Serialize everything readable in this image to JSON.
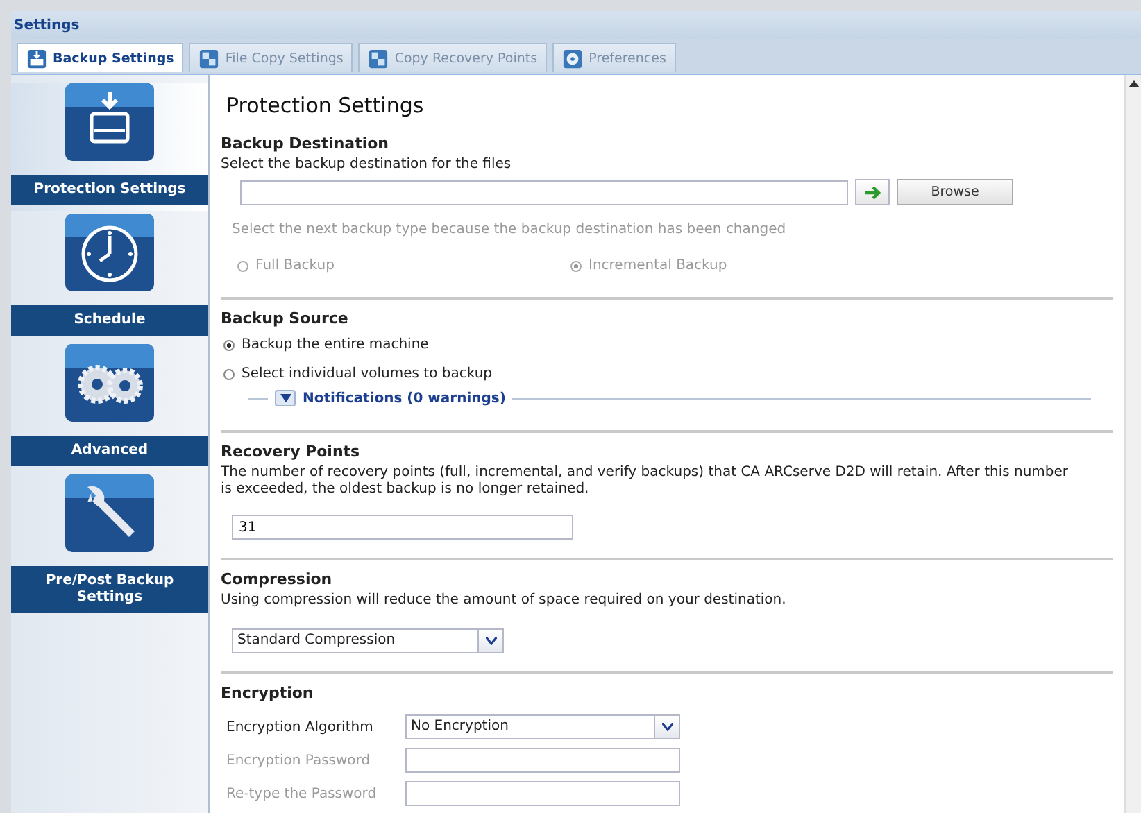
{
  "window": {
    "title": "Settings"
  },
  "tabs": [
    {
      "label": "Backup Settings",
      "kind": "drive",
      "selected": true
    },
    {
      "label": "File Copy Settings",
      "kind": "copy",
      "selected": false
    },
    {
      "label": "Copy Recovery Points",
      "kind": "copy",
      "selected": false
    },
    {
      "label": "Preferences",
      "kind": "disc",
      "selected": false
    }
  ],
  "sidebar": {
    "items": [
      {
        "label": "Protection Settings",
        "kind": "drive",
        "selected": true
      },
      {
        "label": "Schedule",
        "kind": "clock",
        "selected": false
      },
      {
        "label": "Advanced",
        "kind": "gears",
        "selected": false
      },
      {
        "label": "Pre/Post Backup Settings",
        "kind": "wrench",
        "selected": false
      }
    ]
  },
  "content": {
    "title": "Protection Settings",
    "backup_destination": {
      "heading": "Backup Destination",
      "description": "Select the backup destination for the files",
      "browse_button": "Browse",
      "hint": "Select the next backup type because the backup destination has been changed",
      "backup_type": [
        {
          "label": "Full Backup",
          "selected": false,
          "disabled": true
        },
        {
          "label": "Incremental Backup",
          "selected": true,
          "disabled": true
        }
      ]
    },
    "backup_source": {
      "heading": "Backup Source",
      "options": [
        {
          "label": "Backup the entire machine",
          "selected": true
        },
        {
          "label": "Select individual volumes to backup",
          "selected": false
        }
      ],
      "notifications": {
        "label": "Notifications (0 warnings)",
        "expanded": false
      }
    },
    "recovery_points": {
      "heading": "Recovery Points",
      "description": "The number of recovery points (full, incremental, and verify backups) that CA ARCserve D2D will retain. After this number is exceeded, the oldest backup is no longer retained.",
      "value": "31"
    },
    "compression": {
      "heading": "Compression",
      "description": "Using compression will reduce the amount of space required on your destination.",
      "value": "Standard Compression"
    },
    "encryption": {
      "heading": "Encryption",
      "rows": [
        {
          "label": "Encryption Algorithm",
          "kind": "select",
          "value": "No Encryption",
          "disabled": false
        },
        {
          "label": "Encryption Password",
          "kind": "password",
          "disabled": true
        },
        {
          "label": "Re-type the Password",
          "kind": "password",
          "disabled": true
        }
      ]
    }
  }
}
